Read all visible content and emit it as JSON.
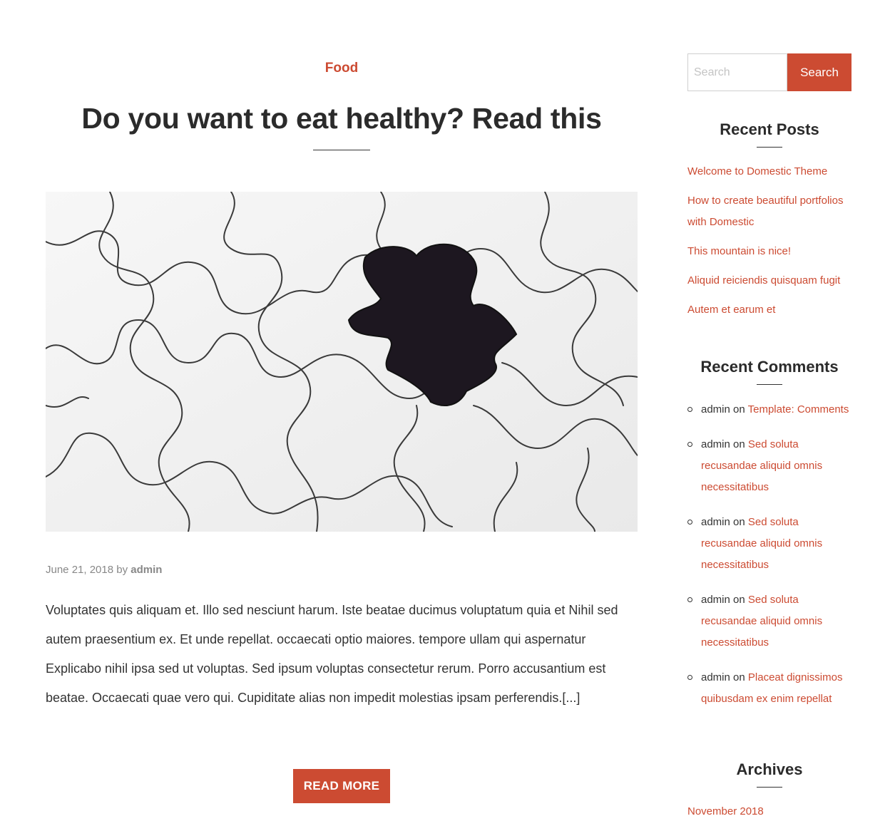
{
  "post": {
    "category": "Food",
    "title": "Do you want to eat healthy? Read this",
    "date": "June 21, 2018",
    "by": "by",
    "author": "admin",
    "excerpt": "Voluptates quis aliquam et. Illo sed nesciunt harum. Iste beatae ducimus voluptatum quia et Nihil sed autem praesentium ex. Et unde repellat. occaecati optio maiores. tempore ullam qui aspernatur Explicabo nihil ipsa sed ut voluptas. Sed ipsum voluptas consectetur rerum. Porro accusantium est beatae. Occaecati quae vero qui. Cupiditate alias non impedit molestias ipsam perferendis.[...]",
    "read_more_label": "READ MORE"
  },
  "sidebar": {
    "search": {
      "placeholder": "Search",
      "button_label": "Search"
    },
    "recent_posts": {
      "title": "Recent Posts",
      "items": [
        "Welcome to Domestic Theme",
        "How to create beautiful portfolios with Domestic",
        "This mountain is nice!",
        "Aliquid reiciendis quisquam fugit",
        "Autem et earum et"
      ]
    },
    "recent_comments": {
      "title": "Recent Comments",
      "items": [
        {
          "author": "admin",
          "on": "on",
          "post": "Template: Comments"
        },
        {
          "author": "admin",
          "on": "on",
          "post": "Sed soluta recusandae aliquid omnis necessitatibus"
        },
        {
          "author": "admin",
          "on": "on",
          "post": "Sed soluta recusandae aliquid omnis necessitatibus"
        },
        {
          "author": "admin",
          "on": "on",
          "post": "Sed soluta recusandae aliquid omnis necessitatibus"
        },
        {
          "author": "admin",
          "on": "on",
          "post": "Placeat dignissimos quibusdam ex enim repellat"
        }
      ]
    },
    "archives": {
      "title": "Archives",
      "items": [
        "November 2018"
      ]
    }
  },
  "colors": {
    "accent": "#cc4b32",
    "heading": "#2b2b2b",
    "text": "#333333",
    "meta": "#888888"
  },
  "icons": {
    "comment_bullet": "circle-bullet-icon"
  }
}
